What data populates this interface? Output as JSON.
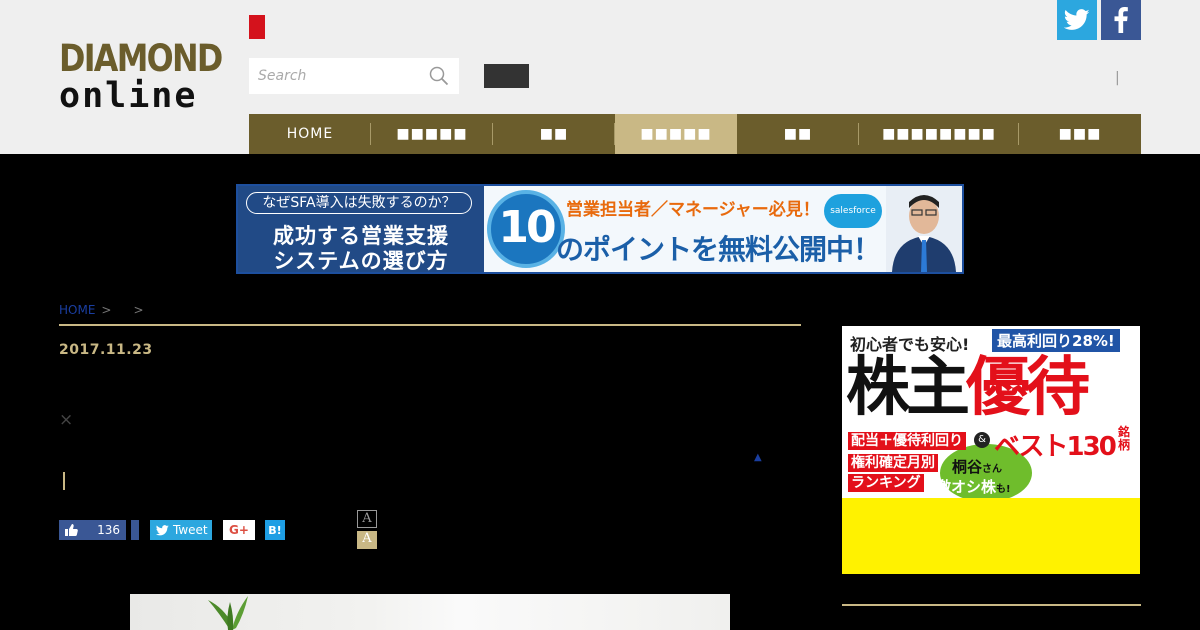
{
  "header": {
    "logo_line1": "DIAMOND",
    "logo_line2": "online",
    "search_placeholder": "Search",
    "pipe": "|",
    "colors": {
      "brand_gold": "#6b5d2c",
      "active_tab": "#c9b885",
      "red_mark": "#d4121c"
    }
  },
  "social": {
    "twitter_icon": "twitter-icon",
    "facebook_icon": "facebook-icon"
  },
  "nav": {
    "items": [
      {
        "label": "HOME"
      },
      {
        "label": "■■■■■"
      },
      {
        "label": "■■"
      },
      {
        "label": "■■■■■",
        "active": true
      },
      {
        "label": "■■"
      },
      {
        "label": "■■■■■■■■"
      },
      {
        "label": "■■■"
      }
    ]
  },
  "banner": {
    "pill": "なぜSFA導入は失敗するのか？",
    "title1": "成功する営業支援",
    "title2": "システムの選び方",
    "ten": "10",
    "sub": "営業担当者／マネージャー必見！",
    "main": "のポイントを無料公開中！",
    "brand": "salesforce"
  },
  "article": {
    "breadcrumb_home": "HOME",
    "breadcrumb_sep1": ">",
    "breadcrumb_sep2": ">",
    "date": "2017.11.23",
    "close": "×",
    "triangle": "▲",
    "share": {
      "like_count": "136",
      "tweet": "Tweet",
      "gplus": "G+",
      "hatena": "B!"
    },
    "font_small": "A",
    "font_large": "A"
  },
  "sidebar_ad": {
    "line1": "初心者でも安心!",
    "badge": "最高利回り28%!",
    "big_black": "株主",
    "big_red": "優待",
    "red1": "配当＋優待利回り",
    "amp": "&",
    "best": "ベスト130",
    "mei": "銘柄",
    "red2": "権利確定月別",
    "red3": "ランキング",
    "kiri": "桐谷",
    "san": "さん",
    "geki": "激オシ株",
    "mo": "も!"
  }
}
